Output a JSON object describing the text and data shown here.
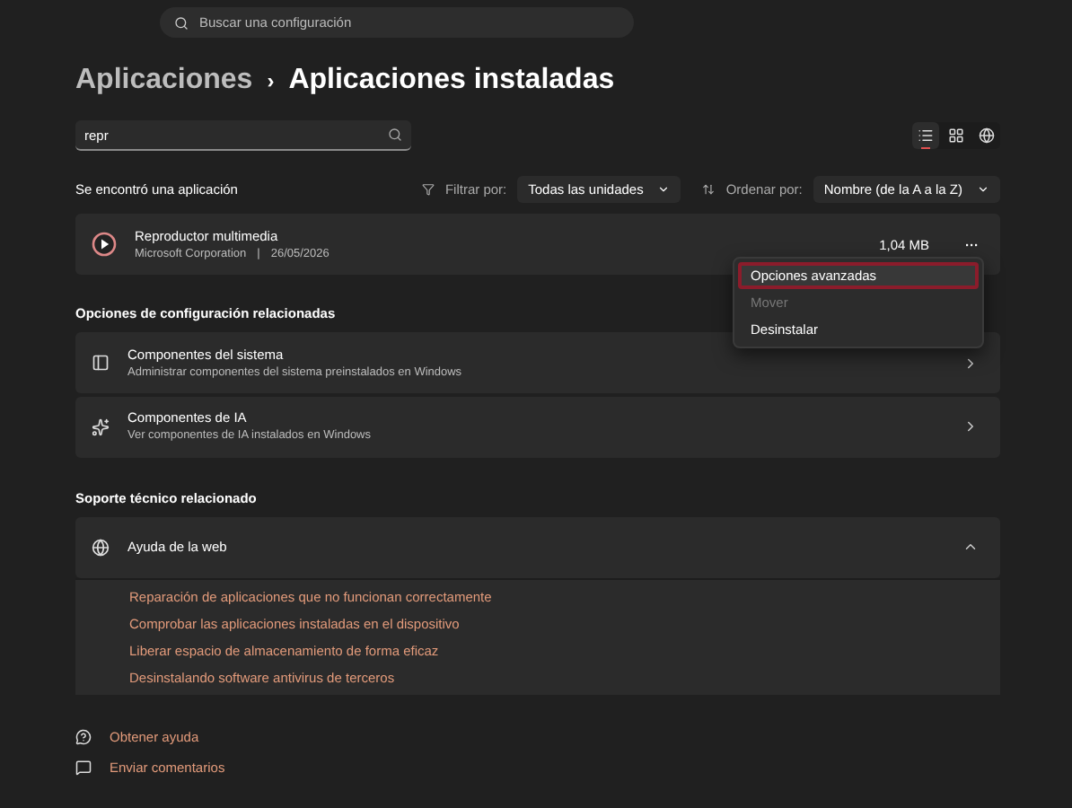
{
  "search": {
    "placeholder": "Buscar una configuración"
  },
  "breadcrumb": {
    "parent": "Aplicaciones",
    "separator": "›",
    "current": "Aplicaciones instaladas"
  },
  "app_search": {
    "value": "repr"
  },
  "view_modes": [
    {
      "kind": "list",
      "selected": true
    },
    {
      "kind": "grid",
      "selected": false
    },
    {
      "kind": "globe",
      "selected": false
    }
  ],
  "result_count": "Se encontró una aplicación",
  "filter": {
    "label": "Filtrar por:",
    "value": "Todas las unidades"
  },
  "sort": {
    "label": "Ordenar por:",
    "value": "Nombre (de la A a la Z)"
  },
  "app": {
    "name": "Reproductor multimedia",
    "publisher": "Microsoft Corporation",
    "separator": "|",
    "date": "26/05/2026",
    "size": "1,04 MB",
    "more": "···"
  },
  "context_menu": [
    {
      "label": "Opciones avanzadas",
      "selected": true,
      "disabled": false
    },
    {
      "label": "Mover",
      "selected": false,
      "disabled": true
    },
    {
      "label": "Desinstalar",
      "selected": false,
      "disabled": false
    }
  ],
  "related_heading": "Opciones de configuración relacionadas",
  "related": [
    {
      "kind": "system",
      "title": "Componentes del sistema",
      "subtitle": "Administrar componentes del sistema preinstalados en Windows"
    },
    {
      "kind": "ai",
      "title": "Componentes de IA",
      "subtitle": "Ver componentes de IA instalados en Windows"
    }
  ],
  "support_heading": "Soporte técnico relacionado",
  "web_help": {
    "title": "Ayuda de la web",
    "expanded": true,
    "links": [
      "Reparación de aplicaciones que no funcionan correctamente",
      "Comprobar las aplicaciones instaladas en el dispositivo",
      "Liberar espacio de almacenamiento de forma eficaz",
      "Desinstalando software antivirus de terceros"
    ]
  },
  "footer": [
    {
      "kind": "help",
      "label": "Obtener ayuda"
    },
    {
      "kind": "feedback",
      "label": "Enviar comentarios"
    }
  ]
}
